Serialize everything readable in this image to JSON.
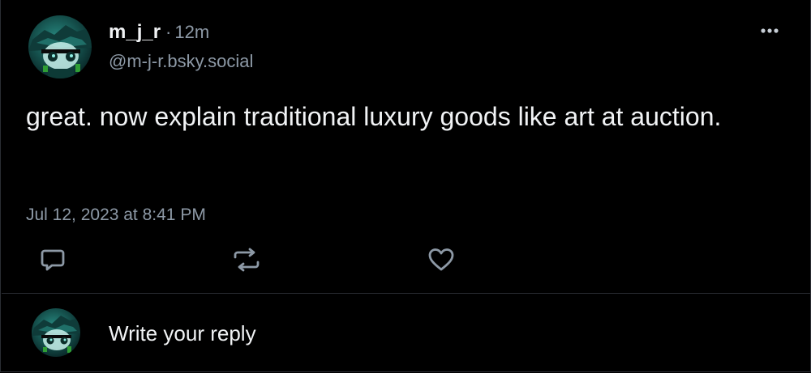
{
  "post": {
    "author_name": "m_j_r",
    "separator": "·",
    "age": "12m",
    "handle": "@m-j-r.bsky.social",
    "text": "great. now explain traditional luxury goods like art at auction.",
    "timestamp": "Jul 12, 2023 at 8:41 PM"
  },
  "actions": {
    "reply_icon": "reply-icon",
    "repost_icon": "repost-icon",
    "like_icon": "heart-icon",
    "more_icon": "ellipsis-icon"
  },
  "composer": {
    "placeholder": "Write your reply"
  },
  "colors": {
    "background": "#000000",
    "text": "#f1f3f5",
    "muted": "#8d99a6",
    "border": "#2a2d33"
  }
}
